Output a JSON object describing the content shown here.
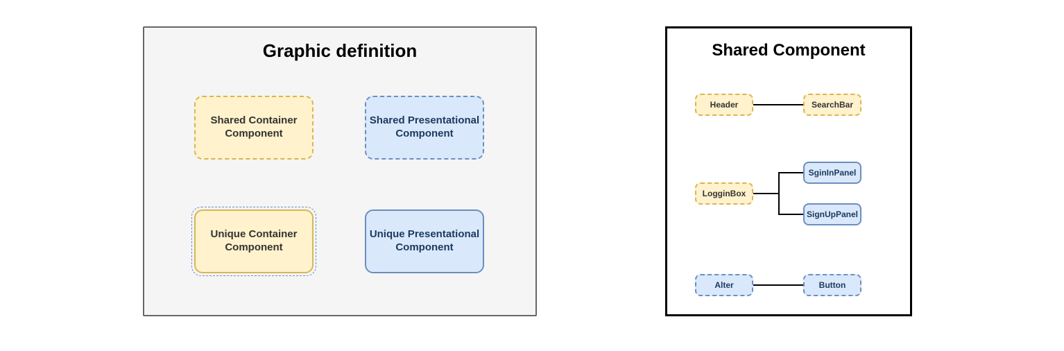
{
  "left_panel": {
    "title": "Graphic definition",
    "cards": {
      "shared_container": "Shared Container Component",
      "shared_presentational": "Shared Presentational Component",
      "unique_container": "Unique Container Component",
      "unique_presentational": "Unique Presentational Component"
    }
  },
  "right_panel": {
    "title": "Shared Component",
    "nodes": {
      "header": "Header",
      "searchbar": "SearchBar",
      "logginbox": "LogginBox",
      "signinpanel": "SginInPanel",
      "signuppanel": "SignUpPanel",
      "alter": "Alter",
      "button": "Button"
    }
  }
}
